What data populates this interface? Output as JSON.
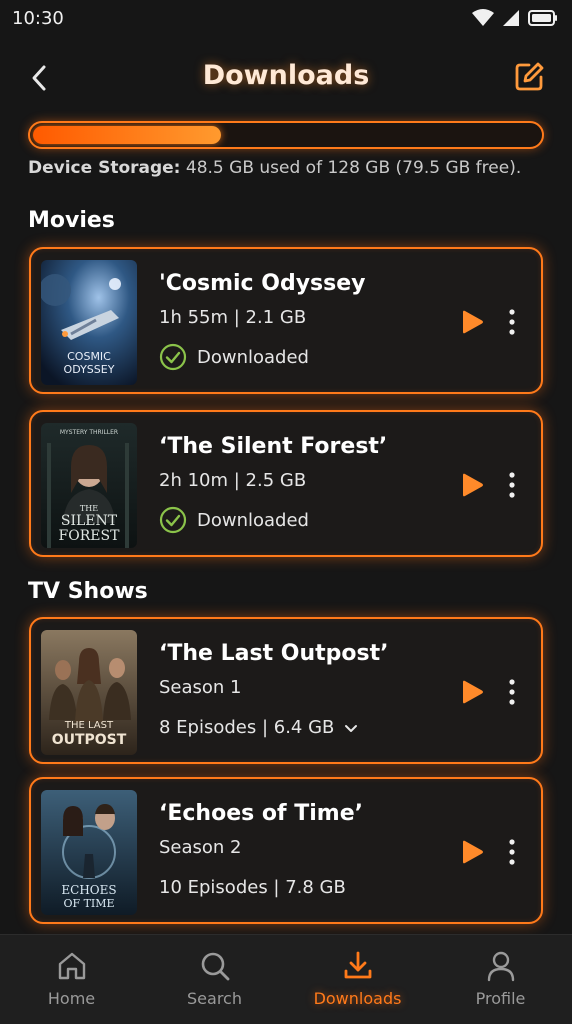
{
  "status_bar": {
    "time": "10:30"
  },
  "header": {
    "title": "Downloads"
  },
  "storage": {
    "label": "Device Storage:",
    "detail": "48.5 GB used of 128 GB (79.5 GB free).",
    "used_fraction": 0.379
  },
  "sections": {
    "movies": "Movies",
    "tv_shows": "TV Shows"
  },
  "movies": [
    {
      "title": "'Cosmic Odyssey",
      "meta": "1h 55m | 2.1 GB",
      "status": "Downloaded",
      "poster_text_1": "COSMIC",
      "poster_text_2": "ODYSSEY"
    },
    {
      "title": "‘The Silent Forest’",
      "meta": "2h 10m | 2.5 GB",
      "status": "Downloaded",
      "poster_tagline": "MYSTERY THRILLER",
      "poster_text_0": "THE",
      "poster_text_1": "SILENT",
      "poster_text_2": "FOREST"
    }
  ],
  "shows": [
    {
      "title": "‘The Last Outpost’",
      "season": "Season 1",
      "episodes": "8 Episodes | 6.4 GB",
      "poster_text_1": "THE LAST",
      "poster_text_2": "OUTPOST"
    },
    {
      "title": "‘Echoes of Time’",
      "season": "Season 2",
      "episodes": "10 Episodes | 7.8 GB",
      "poster_text_1": "ECHOES",
      "poster_text_2": "OF TIME"
    }
  ],
  "nav": {
    "home": "Home",
    "search": "Search",
    "downloads": "Downloads",
    "profile": "Profile",
    "active": "downloads"
  },
  "colors": {
    "accent": "#ff7a1a",
    "background": "#161616",
    "card": "#1c1a19",
    "check": "#8bc34a"
  }
}
